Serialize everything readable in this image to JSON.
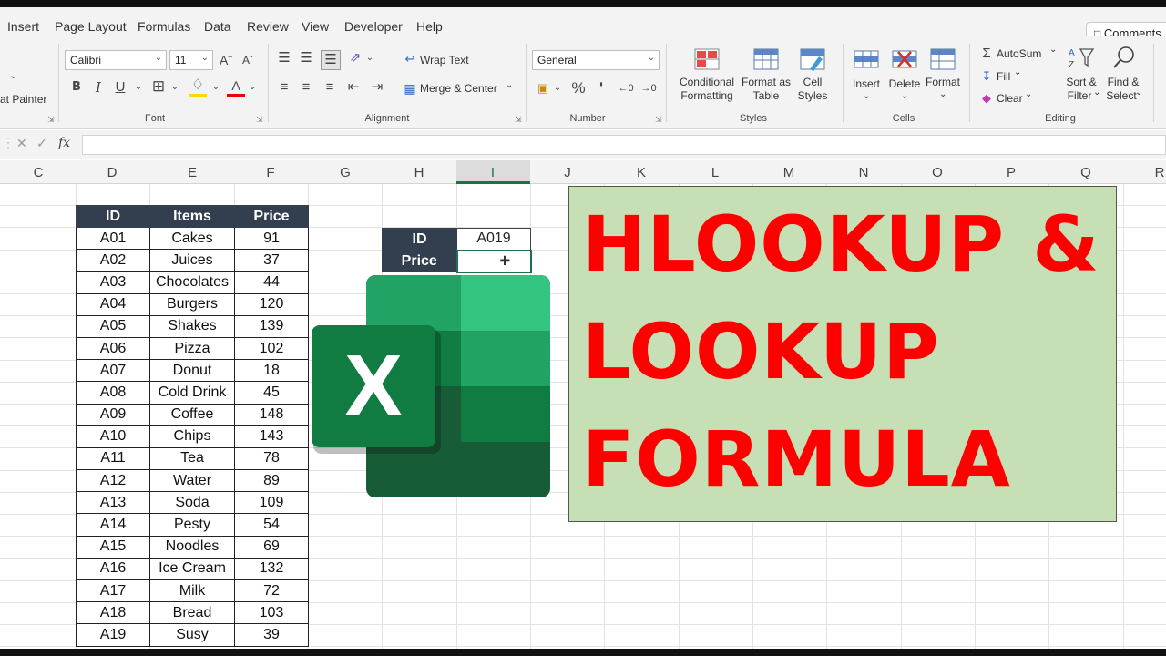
{
  "menu": {
    "items": [
      "Insert",
      "Page Layout",
      "Formulas",
      "Data",
      "Review",
      "View",
      "Developer",
      "Help"
    ],
    "comments_label": "Comments"
  },
  "ribbon": {
    "clipboard": {
      "format_painter": "at Painter"
    },
    "font": {
      "font_name": "Calibri",
      "font_size": "11",
      "group_label": "Font"
    },
    "alignment": {
      "wrap_text": "Wrap Text",
      "merge_center": "Merge & Center",
      "group_label": "Alignment"
    },
    "number": {
      "format": "General",
      "group_label": "Number"
    },
    "styles": {
      "conditional_formatting": [
        "Conditional",
        "Formatting"
      ],
      "format_as_table": [
        "Format as",
        "Table"
      ],
      "cell_styles": [
        "Cell",
        "Styles"
      ],
      "group_label": "Styles"
    },
    "cells": {
      "insert": "Insert",
      "delete": "Delete",
      "format": "Format",
      "group_label": "Cells"
    },
    "editing": {
      "autosum": "AutoSum",
      "fill": "Fill",
      "clear": "Clear",
      "sort_filter": [
        "Sort &",
        "Filter"
      ],
      "find_select": [
        "Find &",
        "Select"
      ],
      "group_label": "Editing"
    }
  },
  "formula_bar": {
    "fx_label": "fx",
    "value": ""
  },
  "columns": [
    "C",
    "D",
    "E",
    "F",
    "G",
    "H",
    "I",
    "J",
    "K",
    "L",
    "M",
    "N",
    "O",
    "P",
    "Q",
    "R"
  ],
  "selected_column": "I",
  "data_table": {
    "headers": [
      "ID",
      "Items",
      "Price"
    ],
    "rows": [
      [
        "A01",
        "Cakes",
        "91"
      ],
      [
        "A02",
        "Juices",
        "37"
      ],
      [
        "A03",
        "Chocolates",
        "44"
      ],
      [
        "A04",
        "Burgers",
        "120"
      ],
      [
        "A05",
        "Shakes",
        "139"
      ],
      [
        "A06",
        "Pizza",
        "102"
      ],
      [
        "A07",
        "Donut",
        "18"
      ],
      [
        "A08",
        "Cold Drink",
        "45"
      ],
      [
        "A09",
        "Coffee",
        "148"
      ],
      [
        "A10",
        "Chips",
        "143"
      ],
      [
        "A11",
        "Tea",
        "78"
      ],
      [
        "A12",
        "Water",
        "89"
      ],
      [
        "A13",
        "Soda",
        "109"
      ],
      [
        "A14",
        "Pesty",
        "54"
      ],
      [
        "A15",
        "Noodles",
        "69"
      ],
      [
        "A16",
        "Ice Cream",
        "132"
      ],
      [
        "A17",
        "Milk",
        "72"
      ],
      [
        "A18",
        "Bread",
        "103"
      ],
      [
        "A19",
        "Susy",
        "39"
      ]
    ]
  },
  "lookup_table": {
    "id_label": "ID",
    "id_value": "A019",
    "price_label": "Price",
    "price_value": ""
  },
  "title": {
    "line1": "HLOOKUP &",
    "line2": "LOOKUP",
    "line3": "FORMULA"
  },
  "logo": {
    "letter": "X"
  },
  "colors": {
    "header_fill": "#333f4f",
    "title_fill": "#c6dfb4",
    "title_text": "#ff0000",
    "excel_green": "#1e7145"
  }
}
